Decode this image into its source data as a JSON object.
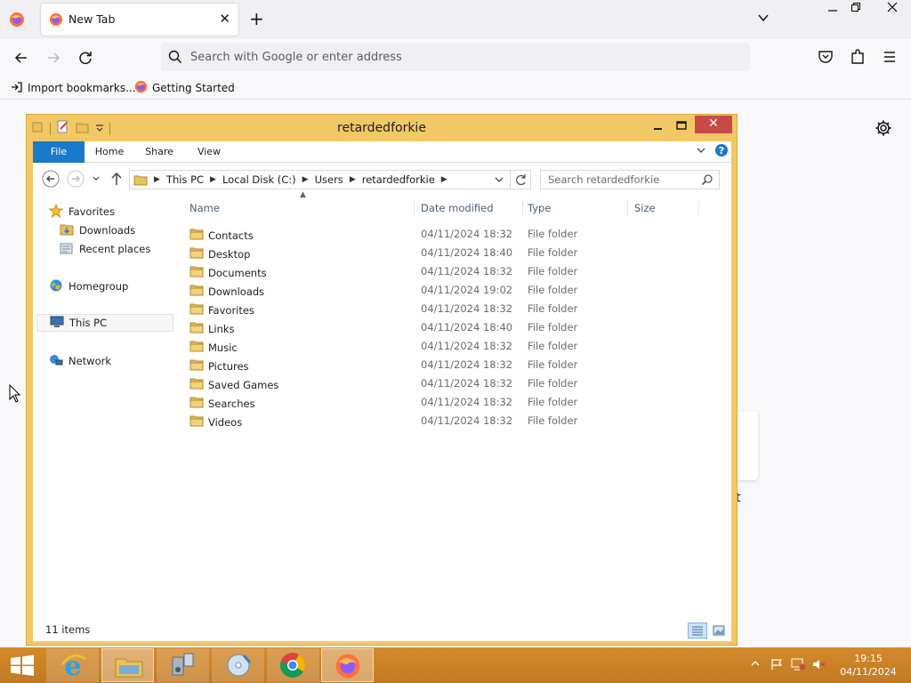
{
  "browser": {
    "tab_title": "New Tab",
    "url_placeholder": "Search with Google or enter address",
    "bookmarks": [
      {
        "label": "Import bookmarks..."
      },
      {
        "label": "Getting Started"
      }
    ],
    "partial_text": "t"
  },
  "explorer": {
    "title": "retardedforkie",
    "ribbon_tabs": [
      "File",
      "Home",
      "Share",
      "View"
    ],
    "breadcrumb": [
      "This PC",
      "Local Disk (C:)",
      "Users",
      "retardedforkie"
    ],
    "search_placeholder": "Search retardedforkie",
    "nav": {
      "favorites": "Favorites",
      "downloads": "Downloads",
      "recent": "Recent places",
      "homegroup": "Homegroup",
      "this_pc": "This PC",
      "network": "Network"
    },
    "columns": {
      "name": "Name",
      "date": "Date modified",
      "type": "Type",
      "size": "Size"
    },
    "files": [
      {
        "name": "Contacts",
        "date": "04/11/2024 18:32",
        "type": "File folder"
      },
      {
        "name": "Desktop",
        "date": "04/11/2024 18:40",
        "type": "File folder"
      },
      {
        "name": "Documents",
        "date": "04/11/2024 18:32",
        "type": "File folder"
      },
      {
        "name": "Downloads",
        "date": "04/11/2024 19:02",
        "type": "File folder"
      },
      {
        "name": "Favorites",
        "date": "04/11/2024 18:32",
        "type": "File folder"
      },
      {
        "name": "Links",
        "date": "04/11/2024 18:40",
        "type": "File folder"
      },
      {
        "name": "Music",
        "date": "04/11/2024 18:32",
        "type": "File folder"
      },
      {
        "name": "Pictures",
        "date": "04/11/2024 18:32",
        "type": "File folder"
      },
      {
        "name": "Saved Games",
        "date": "04/11/2024 18:32",
        "type": "File folder"
      },
      {
        "name": "Searches",
        "date": "04/11/2024 18:32",
        "type": "File folder"
      },
      {
        "name": "Videos",
        "date": "04/11/2024 18:32",
        "type": "File folder"
      }
    ],
    "status": "11 items"
  },
  "taskbar": {
    "time": "19:15",
    "date": "04/11/2024"
  },
  "colors": {
    "explorer_frame": "#f2c866",
    "close_red": "#c74b45",
    "file_tab_blue": "#1979ca",
    "taskbar_orange": "#c9812a",
    "folder_yellow": "#e9c05b"
  }
}
